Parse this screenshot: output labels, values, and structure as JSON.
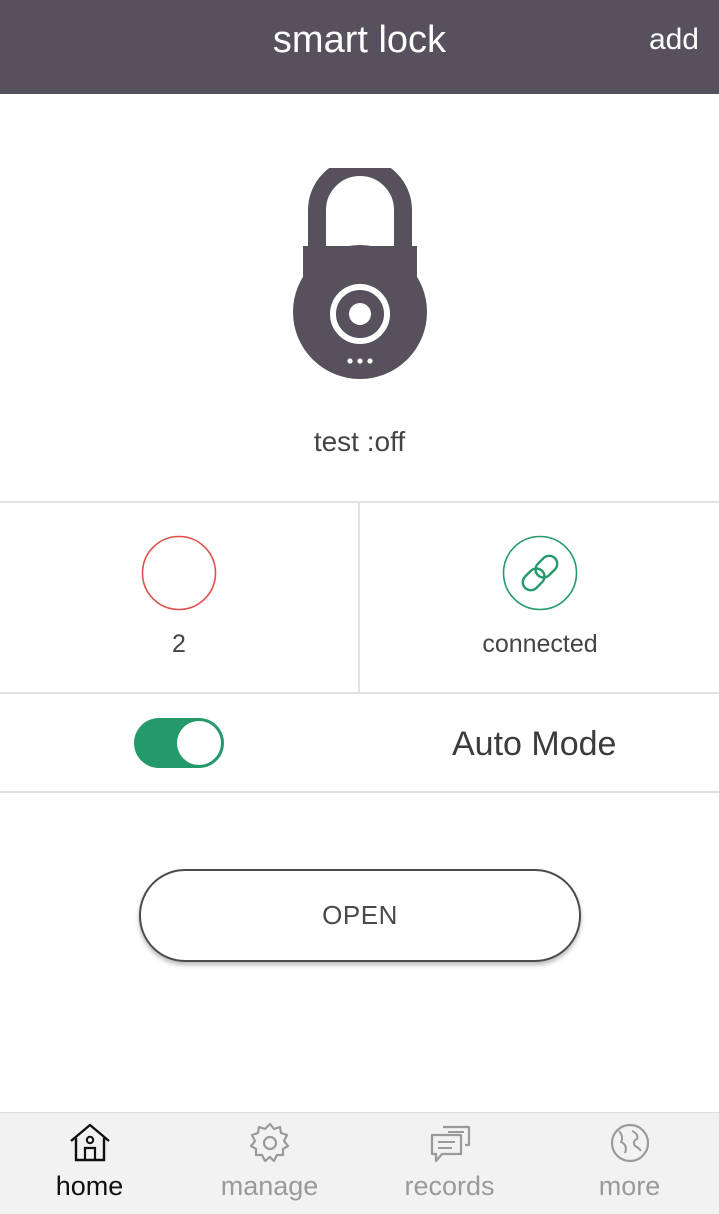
{
  "header": {
    "title": "smart lock",
    "add_label": "add"
  },
  "lock": {
    "icon": "padlock-icon",
    "status_text": "test :off"
  },
  "stats": {
    "count": {
      "icon": "empty-circle-icon",
      "value": "2",
      "color": "#e0504a"
    },
    "connection": {
      "icon": "link-icon",
      "label": "connected",
      "color": "#249a6a"
    }
  },
  "auto_mode": {
    "label": "Auto Mode",
    "enabled": true,
    "color": "#249a6a"
  },
  "open_button": {
    "label": "OPEN"
  },
  "tabbar": {
    "tabs": [
      {
        "label": "home",
        "icon": "home-icon",
        "active": true
      },
      {
        "label": "manage",
        "icon": "gear-icon",
        "active": false
      },
      {
        "label": "records",
        "icon": "records-icon",
        "active": false
      },
      {
        "label": "more",
        "icon": "globe-icon",
        "active": false
      }
    ]
  },
  "colors": {
    "header_bg": "#57505d",
    "lock": "#57505d"
  }
}
